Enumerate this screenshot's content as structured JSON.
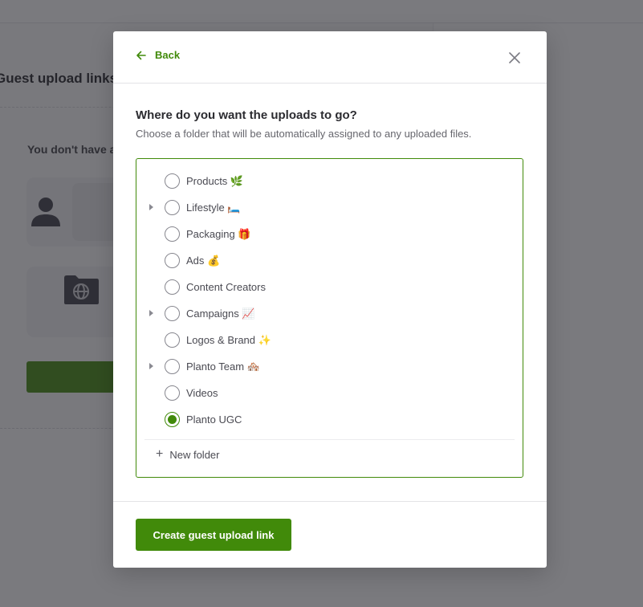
{
  "background": {
    "page_title": "Guest upload links",
    "empty_state_text": "You don't have a"
  },
  "modal": {
    "back_label": "Back",
    "back_icon": "arrow-left-icon",
    "close_icon": "close-icon",
    "question": "Where do you want the uploads to go?",
    "description": "Choose a folder that will be automatically assigned to any uploaded files.",
    "folders": [
      {
        "name": "Products 🌿",
        "expandable": false,
        "selected": false
      },
      {
        "name": "Lifestyle 🛏️",
        "expandable": true,
        "selected": false
      },
      {
        "name": "Packaging 🎁",
        "expandable": false,
        "selected": false
      },
      {
        "name": "Ads 💰",
        "expandable": false,
        "selected": false
      },
      {
        "name": "Content Creators",
        "expandable": false,
        "selected": false
      },
      {
        "name": "Campaigns 📈",
        "expandable": true,
        "selected": false
      },
      {
        "name": "Logos & Brand ✨",
        "expandable": false,
        "selected": false
      },
      {
        "name": "Planto Team 🏘️",
        "expandable": true,
        "selected": false
      },
      {
        "name": "Videos",
        "expandable": false,
        "selected": false
      },
      {
        "name": "Planto UGC",
        "expandable": false,
        "selected": true
      }
    ],
    "new_folder_label": "New folder",
    "create_button_label": "Create guest upload link"
  },
  "colors": {
    "accent": "#418a0a",
    "overlay": "#28282e"
  }
}
